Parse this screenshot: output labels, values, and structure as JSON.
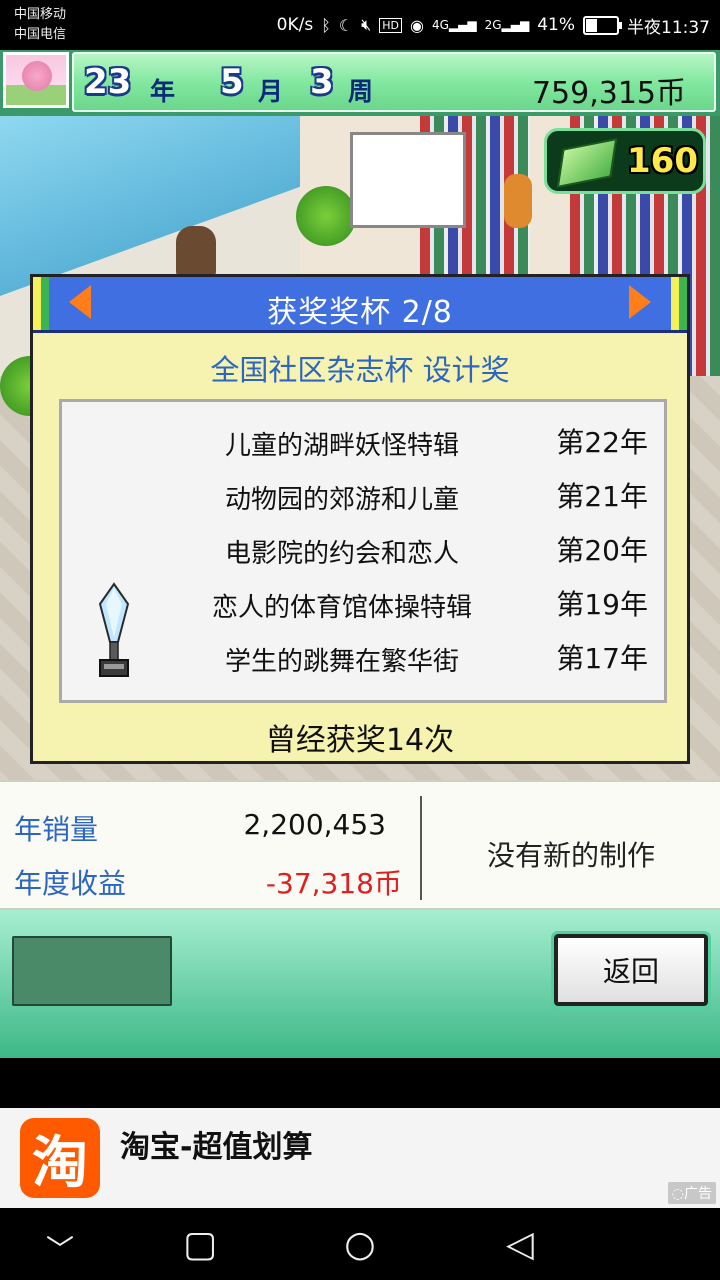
{
  "status_bar": {
    "carrier1": "中国移动",
    "carrier2": "中国电信",
    "net_speed": "0K/s",
    "battery": "41%",
    "time": "半夜11:37",
    "battery_level": 0.41
  },
  "header": {
    "year_num": "23",
    "year_unit": "年",
    "month_num": "5",
    "month_unit": "月",
    "week_num": "3",
    "week_unit": "周",
    "money": "759,315币",
    "gems": "160"
  },
  "award": {
    "title": "获奖奖杯 2/8",
    "name": "全国社区杂志杯 设计奖",
    "winners": [
      {
        "title": "儿童的湖畔妖怪特辑",
        "year": "第22年"
      },
      {
        "title": "动物园的郊游和儿童",
        "year": "第21年"
      },
      {
        "title": "电影院的约会和恋人",
        "year": "第20年"
      },
      {
        "title": "恋人的体育馆体操特辑",
        "year": "第19年"
      },
      {
        "title": "学生的跳舞在繁华街",
        "year": "第17年"
      }
    ],
    "count_text": "曾经获奖14次"
  },
  "info": {
    "sales_label": "年销量",
    "sales_value": "2,200,453",
    "profit_label": "年度收益",
    "profit_value": "-37,318币",
    "no_new": "没有新的制作"
  },
  "buttons": {
    "back": "返回"
  },
  "ad": {
    "logo": "淘",
    "text": "淘宝-超值划算",
    "badge": "◌广告"
  },
  "colors": {
    "accent_blue": "#2c66c2",
    "negative_red": "#e02020",
    "header_blue": "#3f6fe0",
    "arrow_orange": "#ff7d1a"
  }
}
